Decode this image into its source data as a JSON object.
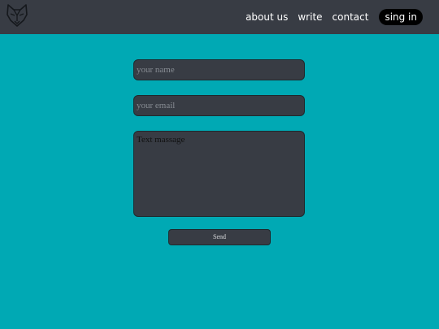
{
  "header": {
    "logo_icon": "wolf-icon",
    "nav": {
      "about_label": "about us",
      "write_label": "write",
      "contact_label": "contact",
      "signin_label": "sing in"
    }
  },
  "form": {
    "name_placeholder": "your name",
    "email_placeholder": "your email",
    "message_value": "Text massage",
    "send_label": "Send"
  },
  "colors": {
    "background": "#00a9b4",
    "header": "#383c44",
    "field": "#383c44",
    "signin": "#000000"
  }
}
